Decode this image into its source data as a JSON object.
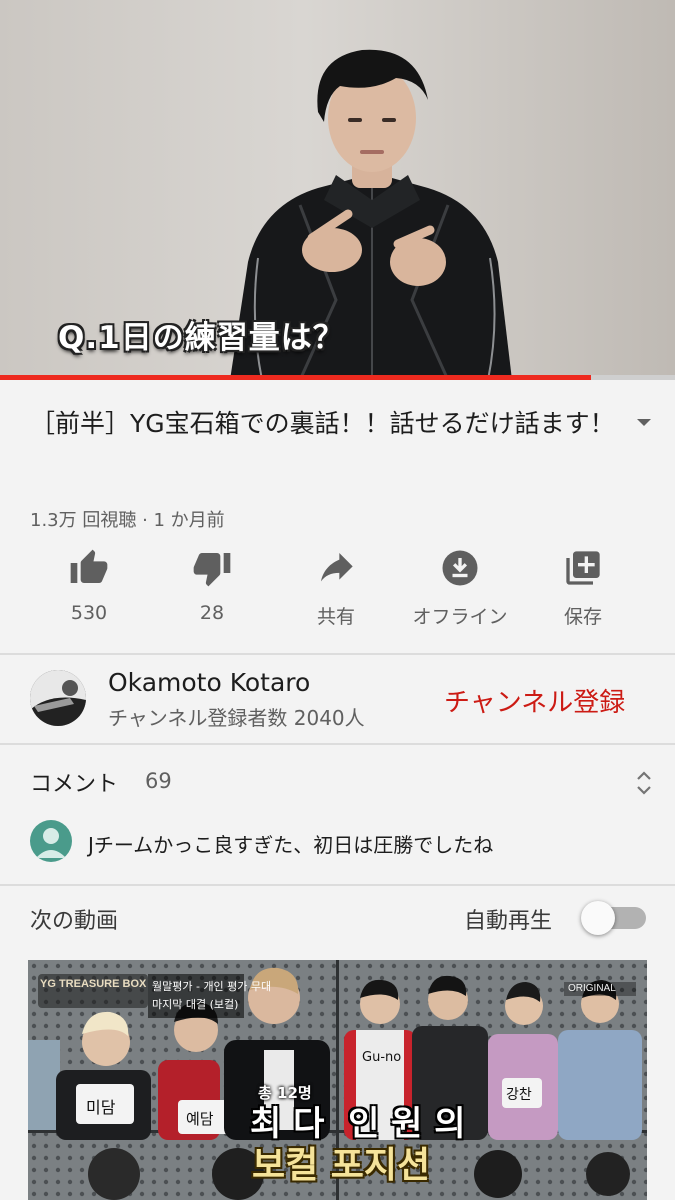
{
  "player": {
    "caption": "Q.1日の練習量は？",
    "progress": 0.876
  },
  "video": {
    "title": "［前半］YG宝石箱での裏話！！話せるだけ話ます！",
    "meta": "1.3万 回視聴 · 1 か月前"
  },
  "actions": [
    {
      "icon": "thumbs-up-icon",
      "label": "530"
    },
    {
      "icon": "thumbs-down-icon",
      "label": "28"
    },
    {
      "icon": "share-icon",
      "label": "共有"
    },
    {
      "icon": "download-icon",
      "label": "オフライン"
    },
    {
      "icon": "playlist-add-icon",
      "label": "保存"
    }
  ],
  "channel": {
    "name": "Okamoto Kotaro",
    "subscribers": "チャンネル登録者数 2040人",
    "subscribe_label": "チャンネル登録"
  },
  "comments": {
    "heading": "コメント",
    "count": "69",
    "top_comment": "Jチームかっこ良すぎた、初日は圧勝でしたね"
  },
  "up_next": {
    "heading": "次の動画",
    "autoplay_label": "自動再生",
    "autoplay_on": false,
    "thumbnail": {
      "logo": "YG TREASURE BOX",
      "badge": "ORIGINAL",
      "lines": [
        "월말평가 - 개인 평가 무대",
        "마지막 대결 (보컬)"
      ],
      "subtitle_small": "총 12명",
      "subtitle_line1": "최 다  인 원 의",
      "subtitle_line2": "보컬 포지션",
      "name_tags": [
        "미담",
        "예담",
        "Gu-no",
        "강찬"
      ]
    }
  },
  "colors": {
    "accent_red": "#cc1b14",
    "progress_red": "#ee2a1f",
    "background": "#f3f3f3",
    "secondary_text": "#606060"
  }
}
